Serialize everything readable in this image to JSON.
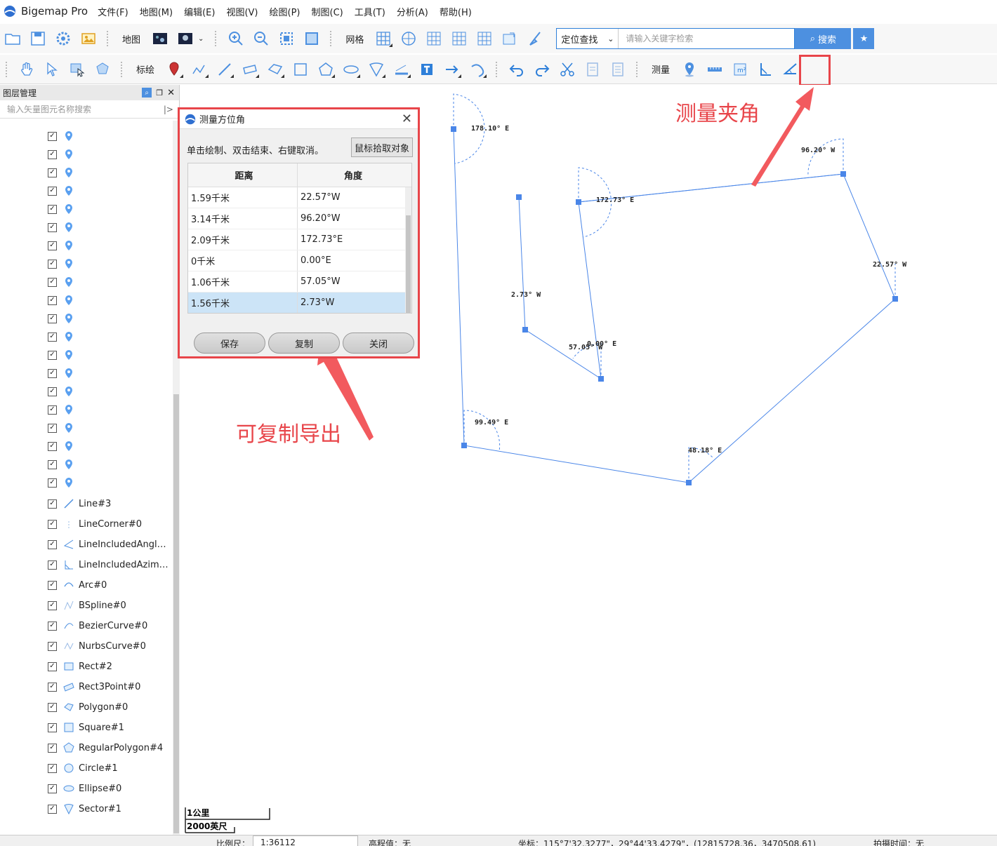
{
  "app": {
    "name": "Bigemap Pro"
  },
  "menu": [
    "文件(F)",
    "地图(M)",
    "编辑(E)",
    "视图(V)",
    "绘图(P)",
    "制图(C)",
    "工具(T)",
    "分析(A)",
    "帮助(H)"
  ],
  "toolbar1": {
    "map_label": "地图",
    "grid_label": "网格",
    "search_mode": "定位查找",
    "search_placeholder": "请输入关键字检索",
    "search_button": "搜索"
  },
  "toolbar2": {
    "draw_label": "标绘",
    "measure_label": "测量"
  },
  "layer_panel": {
    "title": "图层管理",
    "search_placeholder": "输入矢量图元名称搜索",
    "marker_count": 20,
    "items": [
      {
        "name": "Line#3",
        "icon": "line-icon"
      },
      {
        "name": "LineCorner#0",
        "icon": "line-corner-icon"
      },
      {
        "name": "LineIncludedAngle...",
        "icon": "included-angle-icon"
      },
      {
        "name": "LineIncludedAzimu...",
        "icon": "included-azimuth-icon"
      },
      {
        "name": "Arc#0",
        "icon": "arc-icon"
      },
      {
        "name": "BSpline#0",
        "icon": "bspline-icon"
      },
      {
        "name": "BezierCurve#0",
        "icon": "bezier-icon"
      },
      {
        "name": "NurbsCurve#0",
        "icon": "nurbs-icon"
      },
      {
        "name": "Rect#2",
        "icon": "rect-icon"
      },
      {
        "name": "Rect3Point#0",
        "icon": "rect3point-icon"
      },
      {
        "name": "Polygon#0",
        "icon": "polygon-icon"
      },
      {
        "name": "Square#1",
        "icon": "square-icon"
      },
      {
        "name": "RegularPolygon#4",
        "icon": "regular-polygon-icon"
      },
      {
        "name": "Circle#1",
        "icon": "circle-icon"
      },
      {
        "name": "Ellipse#0",
        "icon": "ellipse-icon"
      },
      {
        "name": "Sector#1",
        "icon": "sector-icon"
      }
    ]
  },
  "dialog": {
    "title": "测量方位角",
    "hint": "单击绘制、双击结束、右键取消。",
    "pick_button": "鼠标拾取对象",
    "columns": [
      "距离",
      "角度"
    ],
    "rows": [
      [
        "1.59千米",
        "22.57°W"
      ],
      [
        "3.14千米",
        "96.20°W"
      ],
      [
        "2.09千米",
        "172.73°E"
      ],
      [
        "0千米",
        "0.00°E"
      ],
      [
        "1.06千米",
        "57.05°W"
      ],
      [
        "1.56千米",
        "2.73°W"
      ]
    ],
    "selected_row": 5,
    "buttons": {
      "save": "保存",
      "copy": "复制",
      "close": "关闭"
    }
  },
  "annotations": {
    "measure_angle": "测量夹角",
    "copy_export": "可复制导出"
  },
  "map_labels": [
    "178.10° E",
    "172.73° E",
    "96.20° W",
    "22.57° W",
    "2.73° W",
    "57.05° W",
    "0.00° E",
    "99.49° E",
    "48.18° E"
  ],
  "scale": {
    "km": "1公里",
    "ft": "2000英尺"
  },
  "statusbar": {
    "scale_label": "比例尺：",
    "scale_value": "1:36112",
    "elevation": "高程值：无",
    "coords": "坐标：115°7'32.3277\"，29°44'33.4279\"，(12815728.36，3470508.61)",
    "capture_time": "拍摄时间：无"
  },
  "colors": {
    "accent": "#4d90e0",
    "annotation_red": "#e8454a",
    "line_blue": "#4a86e8"
  }
}
